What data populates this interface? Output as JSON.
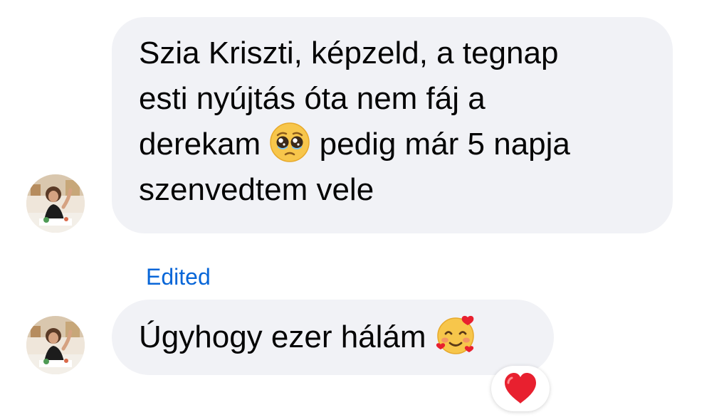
{
  "messages": [
    {
      "lines": [
        "Szia Kriszti, képzeld, a tegnap",
        "esti nyújtás óta nem fáj a",
        "derekam",
        "pedig már 5 napja",
        "szenvedtem vele"
      ],
      "emoji": "pleading-face-emoji",
      "avatar": "sender-avatar"
    },
    {
      "edited_label": "Edited",
      "text": "Úgyhogy ezer hálám",
      "emoji": "smiling-face-with-hearts-emoji",
      "avatar": "sender-avatar",
      "reaction": "red-heart-reaction"
    }
  ],
  "colors": {
    "bubble_background": "#f1f2f6",
    "text": "#050505",
    "edited_label": "#0866d8",
    "reaction_heart": "#e8202f"
  }
}
